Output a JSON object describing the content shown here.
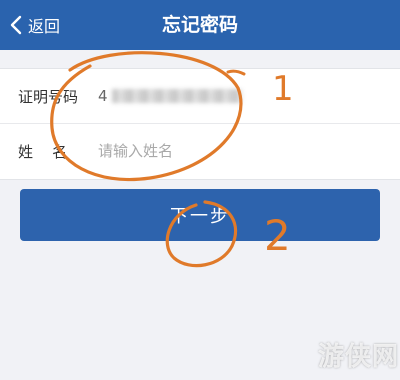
{
  "header": {
    "back_label": "返回",
    "title": "忘记密码",
    "background_color": "#2a63ae"
  },
  "form": {
    "id_label": "证明号码",
    "id_value_prefix": "4",
    "name_label": "姓    名",
    "name_placeholder": "请输入姓名"
  },
  "actions": {
    "next_label": "下一步",
    "button_color": "#2d63ad"
  },
  "annotations": {
    "step1_label": "1",
    "step2_label": "2",
    "stroke_color": "#e07a2a"
  },
  "watermark": {
    "text": "游侠网"
  }
}
